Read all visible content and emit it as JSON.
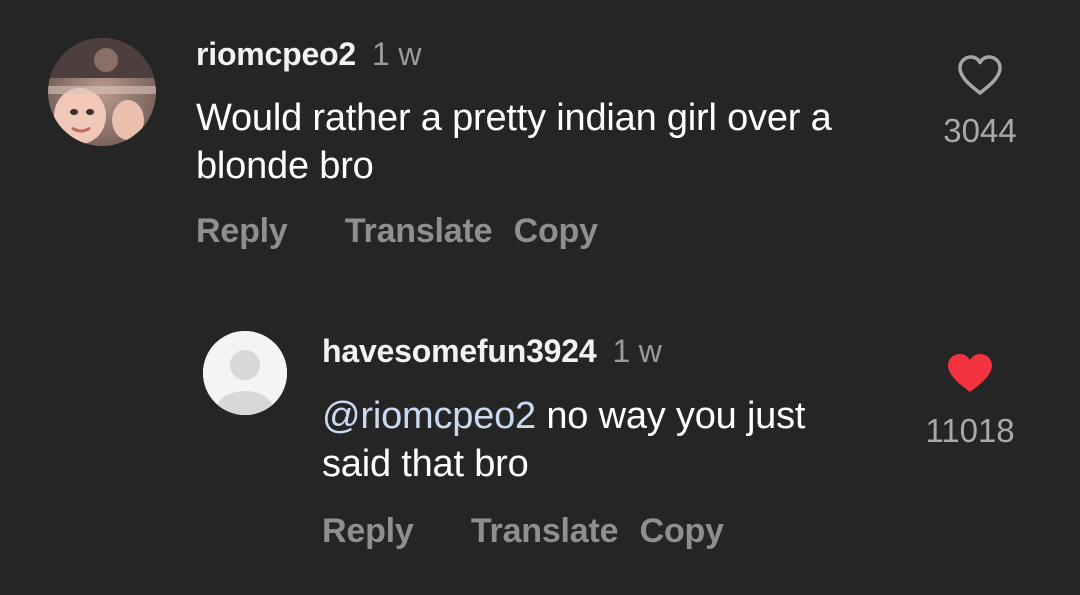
{
  "comments": [
    {
      "username": "riomcpeo2",
      "time": "1 w",
      "text_line1": "Would rather a pretty indian girl over a",
      "text_line2": "blonde bro",
      "actions": {
        "reply": "Reply",
        "translate": "Translate",
        "copy": "Copy"
      },
      "likes": "3044",
      "liked": false,
      "avatar_icon": "user-photo-avatar"
    },
    {
      "username": "havesomefun3924",
      "time": "1 w",
      "mention": "@riomcpeo2",
      "text_line1_rest": " no way you just",
      "text_line2": "said that bro",
      "actions": {
        "reply": "Reply",
        "translate": "Translate",
        "copy": "Copy"
      },
      "likes": "11018",
      "liked": true,
      "avatar_icon": "default-user-avatar"
    }
  ],
  "colors": {
    "background": "#262526",
    "liked_heart": "#f2323f",
    "muted_text": "#8f8f8f",
    "mention": "#c9d9f0"
  },
  "icons": {
    "like_empty": "heart-outline-icon",
    "like_filled": "heart-filled-icon"
  }
}
